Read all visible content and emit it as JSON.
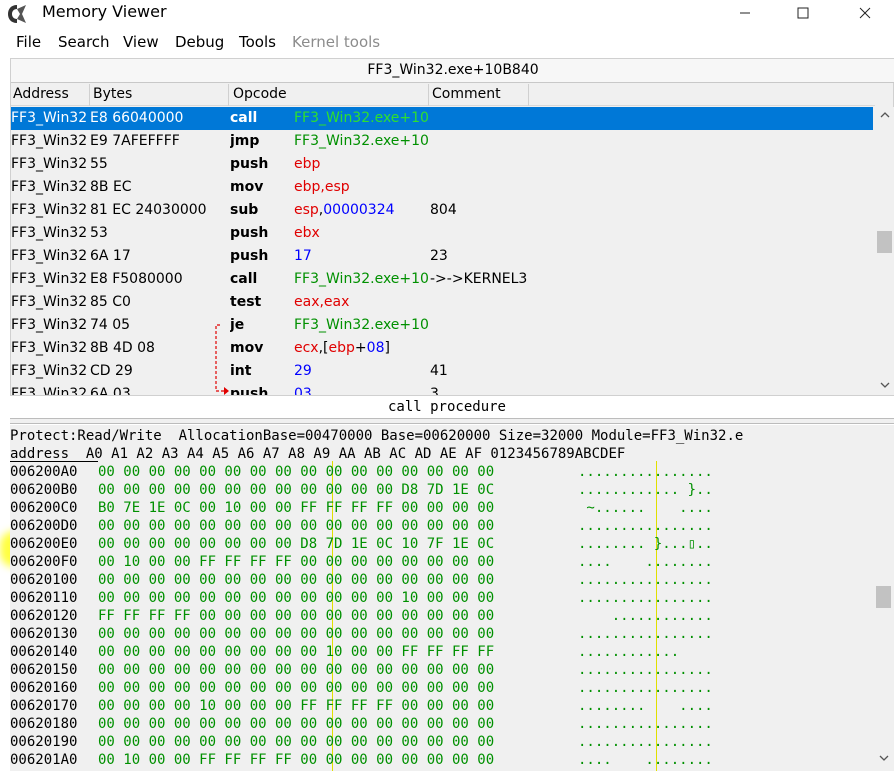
{
  "window": {
    "title": "Memory Viewer",
    "min_icon": "minimize-icon",
    "max_icon": "maximize-icon",
    "close_icon": "close-icon"
  },
  "menu": [
    "File",
    "Search",
    "View",
    "Debug",
    "Tools",
    "Kernel tools"
  ],
  "disassembler": {
    "title": "FF3_Win32.exe+10B840",
    "columns": [
      "Address",
      "Bytes",
      "Opcode",
      "Comment"
    ],
    "rows": [
      {
        "addr": "FF3_Win32",
        "bytes": "E8 66040000",
        "op": "call",
        "args": [
          {
            "t": "FF3_Win32.exe+10",
            "c": "g"
          }
        ],
        "cmt": "",
        "selected": true
      },
      {
        "addr": "FF3_Win32",
        "bytes": "E9 7AFEFFFF",
        "op": "jmp",
        "args": [
          {
            "t": "FF3_Win32.exe+10",
            "c": "g"
          }
        ],
        "cmt": ""
      },
      {
        "addr": "FF3_Win32",
        "bytes": "55",
        "op": "push",
        "args": [
          {
            "t": "ebp",
            "c": "r"
          }
        ],
        "cmt": ""
      },
      {
        "addr": "FF3_Win32",
        "bytes": "8B EC",
        "op": "mov",
        "args": [
          {
            "t": "ebp,esp",
            "c": "r"
          }
        ],
        "cmt": ""
      },
      {
        "addr": "FF3_Win32",
        "bytes": "81 EC 24030000",
        "op": "sub",
        "args": [
          {
            "t": "esp",
            "c": "r"
          },
          {
            "t": ",",
            "c": "k"
          },
          {
            "t": "00000324",
            "c": "b"
          }
        ],
        "cmt": "804"
      },
      {
        "addr": "FF3_Win32",
        "bytes": "53",
        "op": "push",
        "args": [
          {
            "t": "ebx",
            "c": "r"
          }
        ],
        "cmt": ""
      },
      {
        "addr": "FF3_Win32",
        "bytes": "6A 17",
        "op": "push",
        "args": [
          {
            "t": "17",
            "c": "b"
          }
        ],
        "cmt": "23"
      },
      {
        "addr": "FF3_Win32",
        "bytes": "E8 F5080000",
        "op": "call",
        "args": [
          {
            "t": "FF3_Win32.exe+10",
            "c": "g"
          }
        ],
        "cmt": "->->KERNEL3"
      },
      {
        "addr": "FF3_Win32",
        "bytes": "85 C0",
        "op": "test",
        "args": [
          {
            "t": "eax,eax",
            "c": "r"
          }
        ],
        "cmt": ""
      },
      {
        "addr": "FF3_Win32",
        "bytes": "74 05",
        "op": "je",
        "args": [
          {
            "t": "FF3_Win32.exe+10",
            "c": "g"
          }
        ],
        "cmt": ""
      },
      {
        "addr": "FF3_Win32",
        "bytes": "8B 4D 08",
        "op": "mov",
        "args": [
          {
            "t": "ecx",
            "c": "r"
          },
          {
            "t": ",[",
            "c": "k"
          },
          {
            "t": "ebp",
            "c": "r"
          },
          {
            "t": "+",
            "c": "k"
          },
          {
            "t": "08",
            "c": "b"
          },
          {
            "t": "]",
            "c": "k"
          }
        ],
        "cmt": ""
      },
      {
        "addr": "FF3_Win32",
        "bytes": "CD 29",
        "op": "int",
        "args": [
          {
            "t": "29",
            "c": "b"
          }
        ],
        "cmt": "41"
      },
      {
        "addr": "FF3_Win32",
        "bytes": "6A 03",
        "op": "push",
        "args": [
          {
            "t": "03",
            "c": "b"
          }
        ],
        "cmt": "3"
      }
    ]
  },
  "status_line": "call procedure",
  "hex": {
    "protect_line": "Protect:Read/Write  AllocationBase=00470000 Base=00620000 Size=32000 Module=FF3_Win32.e",
    "header": "address  A0 A1 A2 A3 A4 A5 A6 A7 A8 A9 AA AB AC AD AE AF 0123456789ABCDEF",
    "rows": [
      {
        "addr": "006200A0",
        "bytes": "00 00 00 00 00 00 00 00 00 00 00 00 00 00 00 00",
        "ascii": "................"
      },
      {
        "addr": "006200B0",
        "bytes": "00 00 00 00 00 00 00 00 00 00 00 00 D8 7D 1E 0C",
        "ascii": "............ }.."
      },
      {
        "addr": "006200C0",
        "bytes": "B0 7E 1E 0C 00 10 00 00 FF FF FF FF 00 00 00 00",
        "ascii": " ~......    ...."
      },
      {
        "addr": "006200D0",
        "bytes": "00 00 00 00 00 00 00 00 00 00 00 00 00 00 00 00",
        "ascii": "................"
      },
      {
        "addr": "006200E0",
        "bytes": "00 00 00 00 00 00 00 00 D8 7D 1E 0C 10 7F 1E 0C",
        "ascii": "........ }...▯.."
      },
      {
        "addr": "006200F0",
        "bytes": "00 10 00 00 FF FF FF FF 00 00 00 00 00 00 00 00",
        "ascii": "....    ........"
      },
      {
        "addr": "00620100",
        "bytes": "00 00 00 00 00 00 00 00 00 00 00 00 00 00 00 00",
        "ascii": "................"
      },
      {
        "addr": "00620110",
        "bytes": "00 00 00 00 00 00 00 00 00 00 00 00 10 00 00 00",
        "ascii": "................"
      },
      {
        "addr": "00620120",
        "bytes": "FF FF FF FF 00 00 00 00 00 00 00 00 00 00 00 00",
        "ascii": "    ............"
      },
      {
        "addr": "00620130",
        "bytes": "00 00 00 00 00 00 00 00 00 00 00 00 00 00 00 00",
        "ascii": "................"
      },
      {
        "addr": "00620140",
        "bytes": "00 00 00 00 00 00 00 00 00 10 00 00 FF FF FF FF",
        "ascii": "............    "
      },
      {
        "addr": "00620150",
        "bytes": "00 00 00 00 00 00 00 00 00 00 00 00 00 00 00 00",
        "ascii": "................"
      },
      {
        "addr": "00620160",
        "bytes": "00 00 00 00 00 00 00 00 00 00 00 00 00 00 00 00",
        "ascii": "................"
      },
      {
        "addr": "00620170",
        "bytes": "00 00 00 00 10 00 00 00 FF FF FF FF 00 00 00 00",
        "ascii": "........    ...."
      },
      {
        "addr": "00620180",
        "bytes": "00 00 00 00 00 00 00 00 00 00 00 00 00 00 00 00",
        "ascii": "................"
      },
      {
        "addr": "00620190",
        "bytes": "00 00 00 00 00 00 00 00 00 00 00 00 00 00 00 00",
        "ascii": "................"
      },
      {
        "addr": "006201A0",
        "bytes": "00 10 00 00 FF FF FF FF 00 00 00 00 00 00 00 00",
        "ascii": "....    ........"
      }
    ]
  },
  "colors": {
    "selection": "#0078d7",
    "hex_green": "#009000",
    "highlight": "#ffff00"
  }
}
